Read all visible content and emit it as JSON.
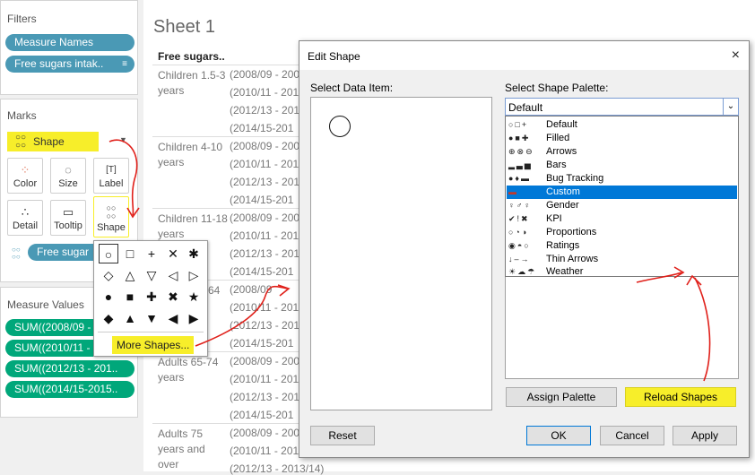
{
  "filters": {
    "title": "Filters",
    "pills": [
      "Measure Names",
      "Free sugars intak.."
    ]
  },
  "marks": {
    "title": "Marks",
    "mark_type": "Shape",
    "buttons": [
      "Color",
      "Size",
      "Label",
      "Detail",
      "Tooltip",
      "Shape"
    ],
    "field_pill": "Free sugar"
  },
  "measure_values": {
    "title": "Measure Values",
    "pills": [
      "SUM((2008/09 - 200..",
      "SUM((2010/11 - 201..",
      "SUM((2012/13 - 201..",
      "SUM((2014/15-2015.."
    ]
  },
  "sheet": {
    "title": "Sheet 1",
    "column_header": "Free sugars..",
    "rows": [
      {
        "label": "Children 1.5-3 years",
        "years": [
          "(2008/09 - 200",
          "(2010/11 - 201",
          "(2012/13 - 201",
          "(2014/15-201"
        ]
      },
      {
        "label": "Children 4-10 years",
        "years": [
          "(2008/09 - 200",
          "(2010/11 - 201",
          "(2012/13 - 201",
          "(2014/15-201"
        ]
      },
      {
        "label": "Children 11-18 years",
        "years": [
          "(2008/09 - 200",
          "(2010/11 - 201",
          "(2012/13 - 201",
          "(2014/15-201"
        ]
      },
      {
        "label": "64",
        "years": [
          "(2008/09",
          "(2010/11 - 201",
          "(2012/13 - 201",
          "(2014/15-201"
        ]
      },
      {
        "label": "Adults 65-74 years",
        "years": [
          "(2008/09 - 200",
          "(2010/11 - 201",
          "(2012/13 - 201",
          "(2014/15-201"
        ]
      },
      {
        "label": "Adults 75 years and over",
        "years": [
          "(2008/09 - 200",
          "(2010/11 - 201",
          "(2012/13 - 2013/14)"
        ]
      }
    ]
  },
  "shape_popup": {
    "more_shapes": "More Shapes..."
  },
  "dialog": {
    "title": "Edit Shape",
    "close": "×",
    "select_data_item": "Select Data Item:",
    "select_palette": "Select Shape Palette:",
    "palette_value": "Default",
    "palettes": [
      {
        "name": "Default",
        "icons": "○□+"
      },
      {
        "name": "Filled",
        "icons": "●■✚"
      },
      {
        "name": "Arrows",
        "icons": "⊕⊗⊖"
      },
      {
        "name": "Bars",
        "icons": "▂▃▅"
      },
      {
        "name": "Bug Tracking",
        "icons": "●♦▬"
      },
      {
        "name": "Custom",
        "icons": "▬"
      },
      {
        "name": "Gender",
        "icons": "♀♂♀"
      },
      {
        "name": "KPI",
        "icons": "✔!✖"
      },
      {
        "name": "Proportions",
        "icons": "○◔◑"
      },
      {
        "name": "Ratings",
        "icons": "◉◓○"
      },
      {
        "name": "Thin Arrows",
        "icons": "↓–→"
      },
      {
        "name": "Weather",
        "icons": "☀☁☂"
      }
    ],
    "selected_palette": "Custom",
    "buttons": {
      "assign_palette": "Assign Palette",
      "reload_shapes": "Reload Shapes",
      "reset": "Reset",
      "ok": "OK",
      "cancel": "Cancel",
      "apply": "Apply"
    }
  },
  "colors": {
    "highlight": "#f7ee2a",
    "pill_blue": "#4a99b5",
    "pill_green": "#00a77a",
    "selection": "#0078d7",
    "annotation": "#e0201a"
  }
}
